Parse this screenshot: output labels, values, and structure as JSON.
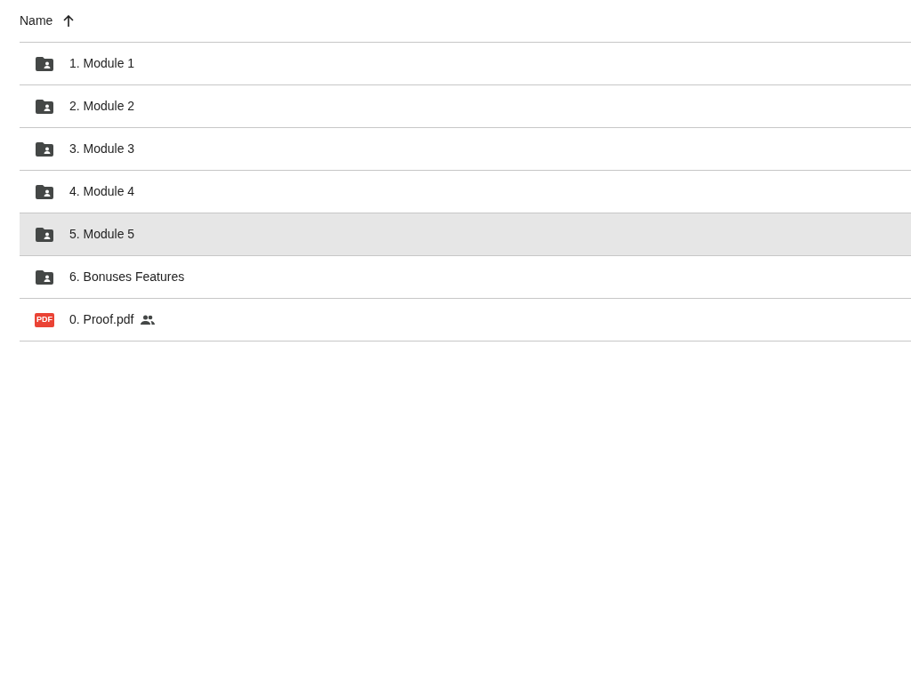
{
  "header": {
    "label": "Name",
    "ascending": true
  },
  "rows": [
    {
      "kind": "folder",
      "name": "1. Module 1",
      "hovered": false,
      "shared": false
    },
    {
      "kind": "folder",
      "name": "2. Module 2",
      "hovered": false,
      "shared": false
    },
    {
      "kind": "folder",
      "name": "3. Module 3",
      "hovered": false,
      "shared": false
    },
    {
      "kind": "folder",
      "name": "4. Module 4",
      "hovered": false,
      "shared": false
    },
    {
      "kind": "folder",
      "name": "5. Module 5",
      "hovered": true,
      "shared": false
    },
    {
      "kind": "folder",
      "name": "6. Bonuses Features",
      "hovered": false,
      "shared": false
    },
    {
      "kind": "pdf",
      "name": "0. Proof.pdf",
      "hovered": false,
      "shared": true,
      "badge": "PDF"
    }
  ]
}
